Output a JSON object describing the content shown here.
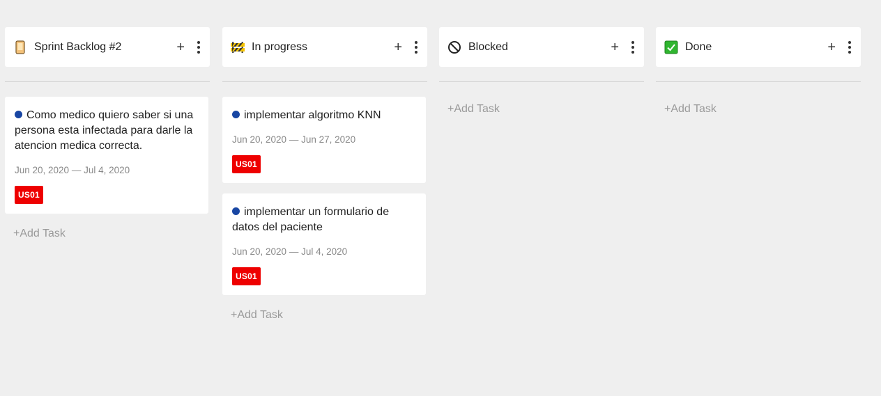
{
  "columns": [
    {
      "title": "Sprint Backlog #2",
      "icon": "phone-icon",
      "add_label": "+",
      "add_task_label": "+Add Task",
      "cards": [
        {
          "title": "Como medico quiero saber si una persona esta infectada para darle la atencion medica correcta.",
          "dates": "Jun 20, 2020 — Jul 4, 2020",
          "tag": "US01"
        }
      ]
    },
    {
      "title": "In progress",
      "icon": "construction-icon",
      "add_label": "+",
      "add_task_label": "+Add Task",
      "cards": [
        {
          "title": "implementar algoritmo KNN",
          "dates": "Jun 20, 2020 — Jun 27, 2020",
          "tag": "US01"
        },
        {
          "title": "implementar un formulario de datos del paciente",
          "dates": "Jun 20, 2020 — Jul 4, 2020",
          "tag": "US01"
        }
      ]
    },
    {
      "title": "Blocked",
      "icon": "prohibited-icon",
      "add_label": "+",
      "add_task_label": "+Add Task",
      "cards": []
    },
    {
      "title": "Done",
      "icon": "check-box-icon",
      "add_label": "+",
      "add_task_label": "+Add Task",
      "cards": []
    }
  ],
  "colors": {
    "tag": "#ee0000",
    "dot": "#1846a3",
    "check": "#2fb52f"
  }
}
